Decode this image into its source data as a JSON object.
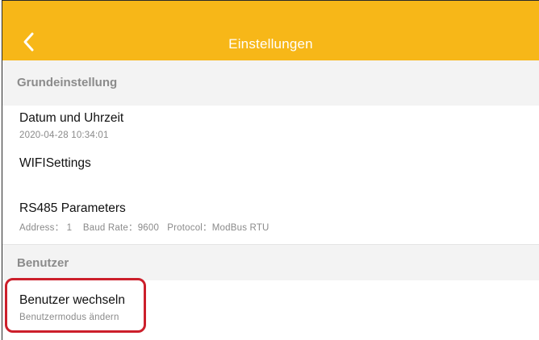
{
  "header": {
    "title": "Einstellungen",
    "back_icon": "chevron-left-icon",
    "background_color": "#f7b718",
    "title_color": "#ffffff"
  },
  "sections": {
    "grundeinstellung": {
      "label": "Grundeinstellung",
      "items": [
        {
          "title": "Datum und Uhrzeit",
          "subtitle": "2020-04-28 10:34:01"
        },
        {
          "title": "WIFISettings",
          "subtitle": ""
        },
        {
          "title": "RS485 Parameters",
          "subtitle": "Address： 1    Baud Rate：9600   Protocol：ModBus RTU"
        }
      ]
    },
    "benutzer": {
      "label": "Benutzer",
      "items": [
        {
          "title": "Benutzer wechseln",
          "subtitle": "Benutzermodus ändern"
        }
      ]
    }
  },
  "highlight_color": "#cc1f2b"
}
